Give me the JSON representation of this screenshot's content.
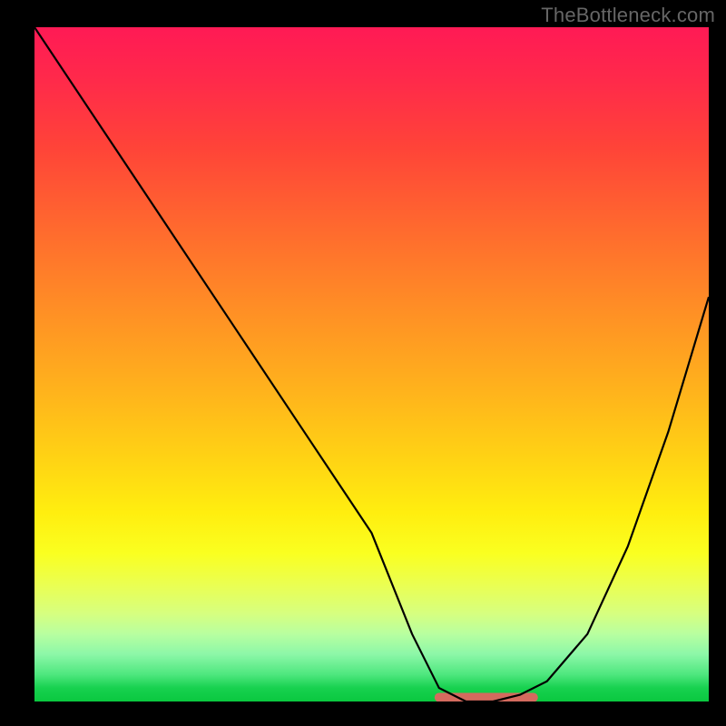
{
  "watermark": "TheBottleneck.com",
  "chart_data": {
    "type": "line",
    "title": "",
    "xlabel": "",
    "ylabel": "",
    "xlim": [
      0,
      100
    ],
    "ylim": [
      0,
      100
    ],
    "series": [
      {
        "name": "bottleneck-curve",
        "x": [
          0,
          10,
          20,
          30,
          40,
          50,
          56,
          60,
          64,
          68,
          72,
          76,
          82,
          88,
          94,
          100
        ],
        "values": [
          100,
          85,
          70,
          55,
          40,
          25,
          10,
          2,
          0,
          0,
          1,
          3,
          10,
          23,
          40,
          60
        ]
      }
    ],
    "annotations": [
      {
        "name": "highlight-band",
        "x_start": 60,
        "x_end": 74,
        "color": "#d46a5e"
      }
    ],
    "gradient_colors": {
      "top": "#ff1a55",
      "upper_mid": "#ff8f25",
      "mid": "#ffee0f",
      "lower_mid": "#b8ffa0",
      "bottom": "#0ac83f"
    }
  }
}
